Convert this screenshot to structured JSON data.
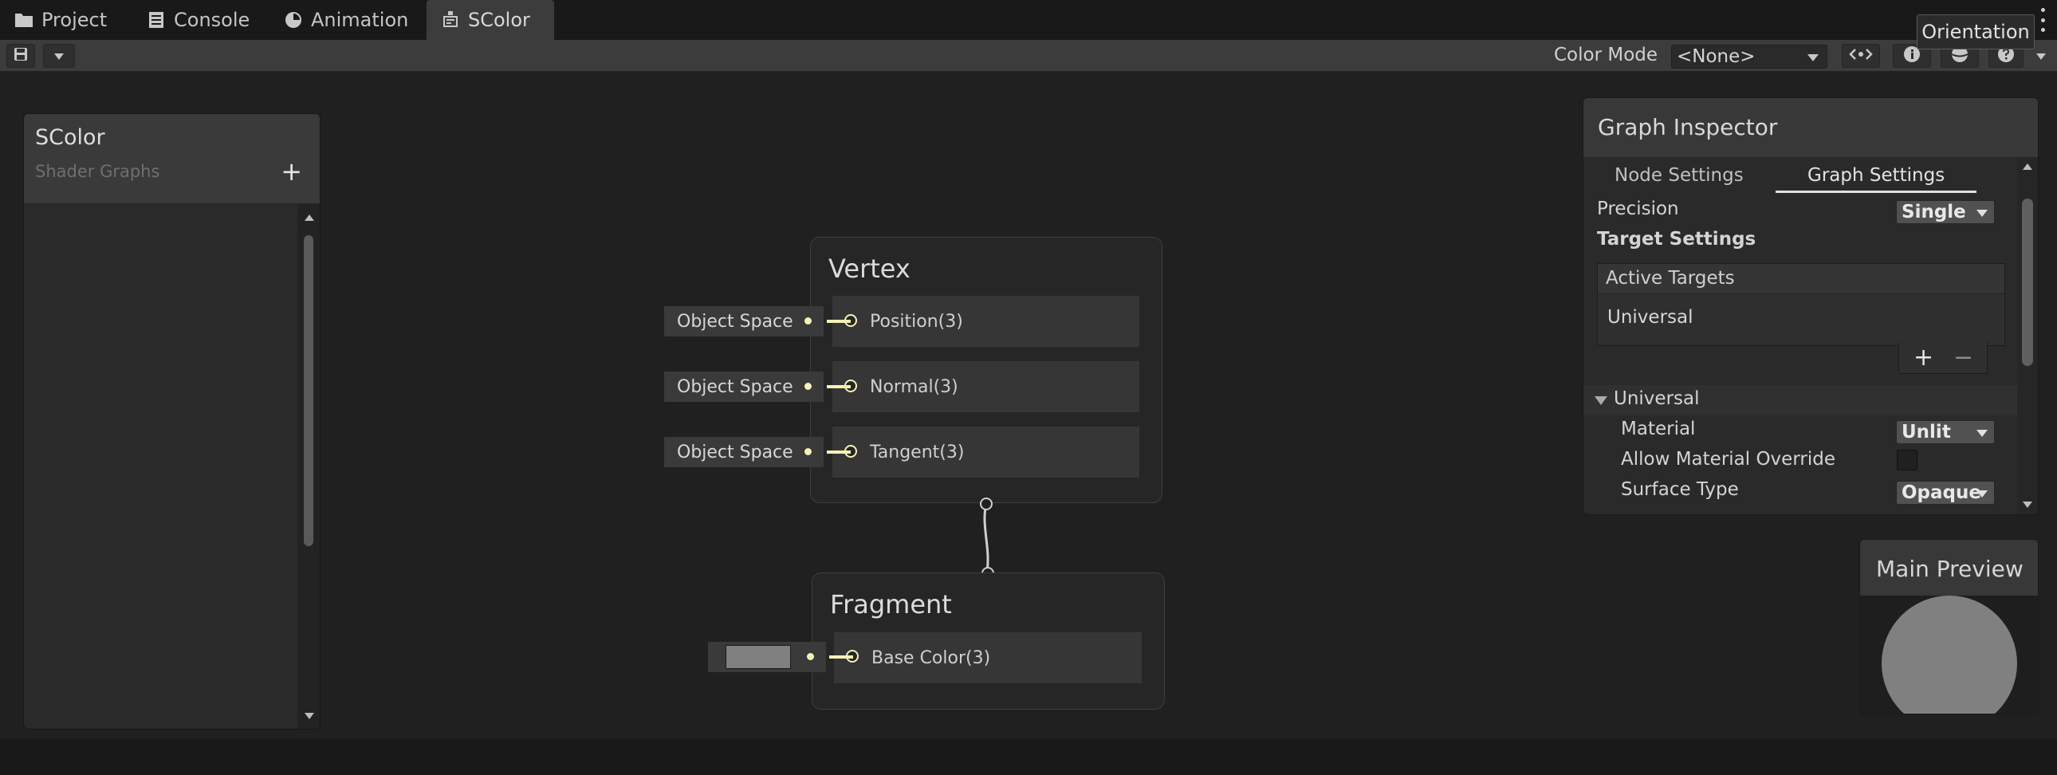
{
  "tabs": [
    {
      "label": "Project",
      "icon": "folder-icon"
    },
    {
      "label": "Console",
      "icon": "console-icon"
    },
    {
      "label": "Animation",
      "icon": "animation-icon"
    },
    {
      "label": "SColor",
      "icon": "shader-graph-icon",
      "active": true
    }
  ],
  "tooltip": "Orientation",
  "toolbar": {
    "color_mode_label": "Color Mode",
    "color_mode_value": "<None>"
  },
  "blackboard": {
    "title": "SColor",
    "subtitle": "Shader Graphs",
    "add": "+"
  },
  "vertex": {
    "title": "Vertex",
    "blocks": [
      {
        "label": "Position(3)",
        "input": "Object Space"
      },
      {
        "label": "Normal(3)",
        "input": "Object Space"
      },
      {
        "label": "Tangent(3)",
        "input": "Object Space"
      }
    ]
  },
  "fragment": {
    "title": "Fragment",
    "blocks": [
      {
        "label": "Base Color(3)",
        "swatch": "#808080"
      }
    ]
  },
  "inspector": {
    "title": "Graph Inspector",
    "tab_node": "Node Settings",
    "tab_graph": "Graph Settings",
    "precision_label": "Precision",
    "precision_value": "Single",
    "target_settings": "Target Settings",
    "active_targets": "Active Targets",
    "target_item": "Universal",
    "plus": "+",
    "minus": "−",
    "section": "Universal",
    "material_label": "Material",
    "material_value": "Unlit",
    "override_label": "Allow Material Override",
    "surface_label": "Surface Type",
    "surface_value": "Opaque"
  },
  "preview": {
    "title": "Main Preview",
    "sphere_color": "#808080"
  },
  "colors": {
    "port_yellow": "#f5f2b6",
    "canvas": "#202020",
    "panel": "#2a2a2a"
  }
}
